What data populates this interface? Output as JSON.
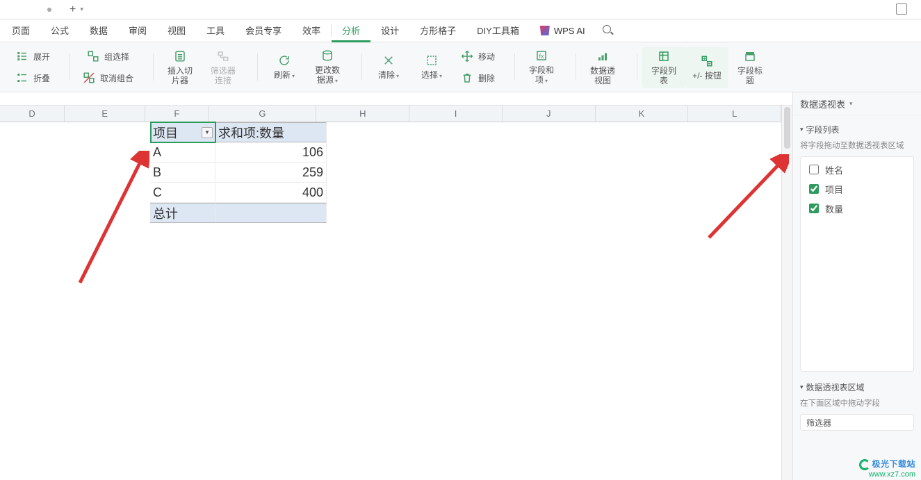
{
  "tabbar": {
    "plus": "+",
    "drop": "▾"
  },
  "menu": {
    "items": [
      "页面",
      "公式",
      "数据",
      "审阅",
      "视图",
      "工具",
      "会员专享",
      "效率"
    ],
    "items2": [
      "分析",
      "设计",
      "方形格子",
      "DIY工具箱"
    ],
    "ai_label": "WPS AI"
  },
  "ribbon": {
    "expand": "展开",
    "collapse": "折叠",
    "group": "组选择",
    "ungroup": "取消组合",
    "slicer": "插入切片器",
    "filter_conn": "筛选器连接",
    "refresh": "刷新",
    "change_src": "更改数据源",
    "clear": "清除",
    "select": "选择",
    "move": "移动",
    "delete": "删除",
    "field_sum": "字段和项",
    "pivot_chart": "数据透视图",
    "field_list": "字段列表",
    "pm_button": "+/- 按钮",
    "field_header": "字段标题"
  },
  "columns": [
    "D",
    "E",
    "F",
    "G",
    "H",
    "I",
    "J",
    "K",
    "L"
  ],
  "pivot": {
    "header_item": "项目",
    "header_sum": "求和项:数量",
    "rows": [
      {
        "label": "A",
        "value": "106"
      },
      {
        "label": "B",
        "value": "259"
      },
      {
        "label": "C",
        "value": "400"
      }
    ],
    "total": "总计"
  },
  "panel": {
    "title": "数据透视表",
    "field_list_title": "字段列表",
    "drag_hint": "将字段拖动至数据透视表区域",
    "fields": [
      {
        "label": "姓名",
        "checked": false
      },
      {
        "label": "项目",
        "checked": true
      },
      {
        "label": "数量",
        "checked": true
      }
    ],
    "area_title": "数据透视表区域",
    "area_hint": "在下面区域中拖动字段",
    "filter_label": "筛选器"
  },
  "watermark": {
    "top": "极光下载站",
    "bottom": "www.xz7.com"
  }
}
